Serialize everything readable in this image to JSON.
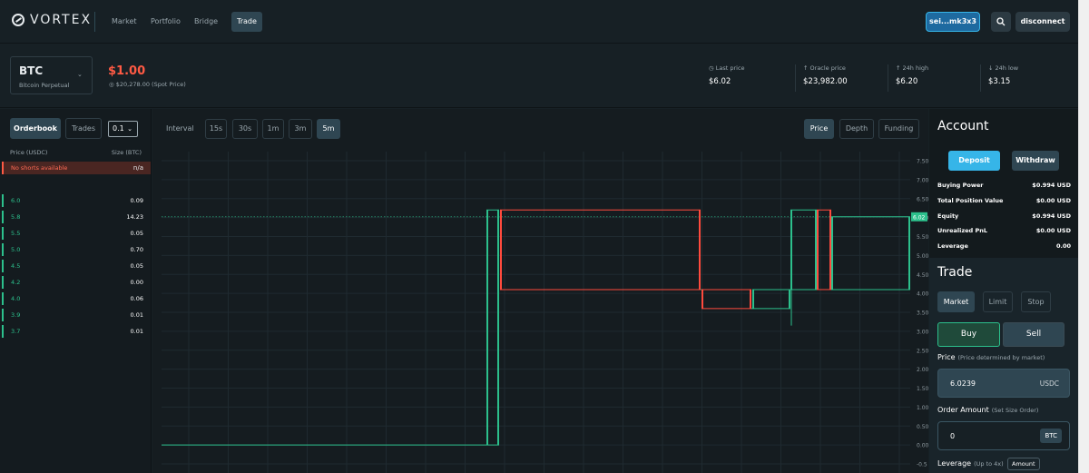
{
  "nav": {
    "brand": "VORTEX",
    "items": [
      "Market",
      "Portfolio",
      "Bridge",
      "Trade"
    ],
    "active": "Trade",
    "wallet": "sei...mk3x3",
    "disconnect": "disconnect",
    "search_icon": "search-icon"
  },
  "market": {
    "symbol": "BTC",
    "name": "Bitcoin Perpetual",
    "mark_price": "$1.00",
    "spot_price": "$20,278.00 (Spot Price)",
    "stats": [
      {
        "label": "Last price",
        "value": "$6.02",
        "icon": "clock-icon"
      },
      {
        "label": "Oracle price",
        "value": "$23,982.00",
        "icon": "arrow-up-icon"
      },
      {
        "label": "24h high",
        "value": "$6.20",
        "icon": "arrow-up-icon"
      },
      {
        "label": "24h low",
        "value": "$3.15",
        "icon": "arrow-down-icon"
      }
    ]
  },
  "orderbook": {
    "tabs": [
      "Orderbook",
      "Trades"
    ],
    "precision": "0.1",
    "price_header": "Price (USDC)",
    "size_header": "Size (BTC)",
    "no_shorts": "No shorts available",
    "no_shorts_size": "n/a",
    "bids": [
      {
        "price": "6.0",
        "size": "0.09"
      },
      {
        "price": "5.8",
        "size": "14.23"
      },
      {
        "price": "5.5",
        "size": "0.05"
      },
      {
        "price": "5.0",
        "size": "0.70"
      },
      {
        "price": "4.5",
        "size": "0.05"
      },
      {
        "price": "4.2",
        "size": "0.00"
      },
      {
        "price": "4.0",
        "size": "0.06"
      },
      {
        "price": "3.9",
        "size": "0.01"
      },
      {
        "price": "3.7",
        "size": "0.01"
      }
    ]
  },
  "chart_controls": {
    "interval_label": "Interval",
    "intervals": [
      "15s",
      "30s",
      "1m",
      "3m",
      "5m"
    ],
    "active_interval": "5m",
    "views": [
      "Price",
      "Depth",
      "Funding"
    ],
    "active_view": "Price"
  },
  "chart_data": {
    "type": "line",
    "y_ticks": [
      "7.50",
      "7.00",
      "6.50",
      "6.00",
      "5.50",
      "5.00",
      "4.50",
      "4.00",
      "3.50",
      "3.00",
      "2.50",
      "2.00",
      "1.50",
      "1.00",
      "0.50",
      "0.00",
      "-0.5"
    ],
    "ylim": [
      -0.5,
      7.5
    ],
    "last_price_label": "6.02",
    "last_price": 6.02,
    "candles": [
      {
        "o": 0.0,
        "c": 0.0,
        "h": 0.0,
        "l": 0.0
      },
      {
        "o": 0.0,
        "c": 6.2,
        "h": 6.2,
        "l": 0.0
      },
      {
        "o": 6.2,
        "c": 4.1,
        "h": 6.2,
        "l": 4.1
      },
      {
        "o": 4.1,
        "c": 4.1,
        "h": 4.1,
        "l": 4.1
      },
      {
        "o": 4.1,
        "c": 3.6,
        "h": 4.1,
        "l": 3.6
      },
      {
        "o": 3.6,
        "c": 3.6,
        "h": 3.6,
        "l": 3.6
      },
      {
        "o": 3.6,
        "c": 4.1,
        "h": 4.1,
        "l": 3.6
      },
      {
        "o": 4.1,
        "c": 6.2,
        "h": 6.2,
        "l": 3.15
      },
      {
        "o": 6.2,
        "c": 4.1,
        "h": 6.2,
        "l": 4.1
      },
      {
        "o": 4.1,
        "c": 6.02,
        "h": 6.02,
        "l": 4.1
      },
      {
        "o": 6.02,
        "c": 6.02,
        "h": 6.02,
        "l": 6.02
      }
    ]
  },
  "account": {
    "title": "Account",
    "deposit": "Deposit",
    "withdraw": "Withdraw",
    "rows": [
      {
        "label": "Buying Power",
        "value": "$0.994 USD"
      },
      {
        "label": "Total Position Value",
        "value": "$0.00 USD"
      },
      {
        "label": "Equity",
        "value": "$0.994 USD"
      },
      {
        "label": "Unrealized PnL",
        "value": "$0.00 USD"
      },
      {
        "label": "Leverage",
        "value": "0.00"
      }
    ]
  },
  "trade": {
    "title": "Trade",
    "tabs": [
      "Market",
      "Limit",
      "Stop"
    ],
    "active_tab": "Market",
    "buy": "Buy",
    "sell": "Sell",
    "price_label": "Price",
    "price_hint": "(Price determined by market)",
    "price_value": "6.0239",
    "price_unit": "USDC",
    "amount_label": "Order Amount",
    "amount_hint": "(Set Size Order)",
    "amount_value": "0",
    "amount_unit": "BTC",
    "leverage_label": "Leverage",
    "leverage_hint": "(Up to 4x)",
    "leverage_mode": "Amount"
  },
  "colors": {
    "up": "#2cc08c",
    "down": "#ff4a3d",
    "accent": "#36b5e8"
  }
}
